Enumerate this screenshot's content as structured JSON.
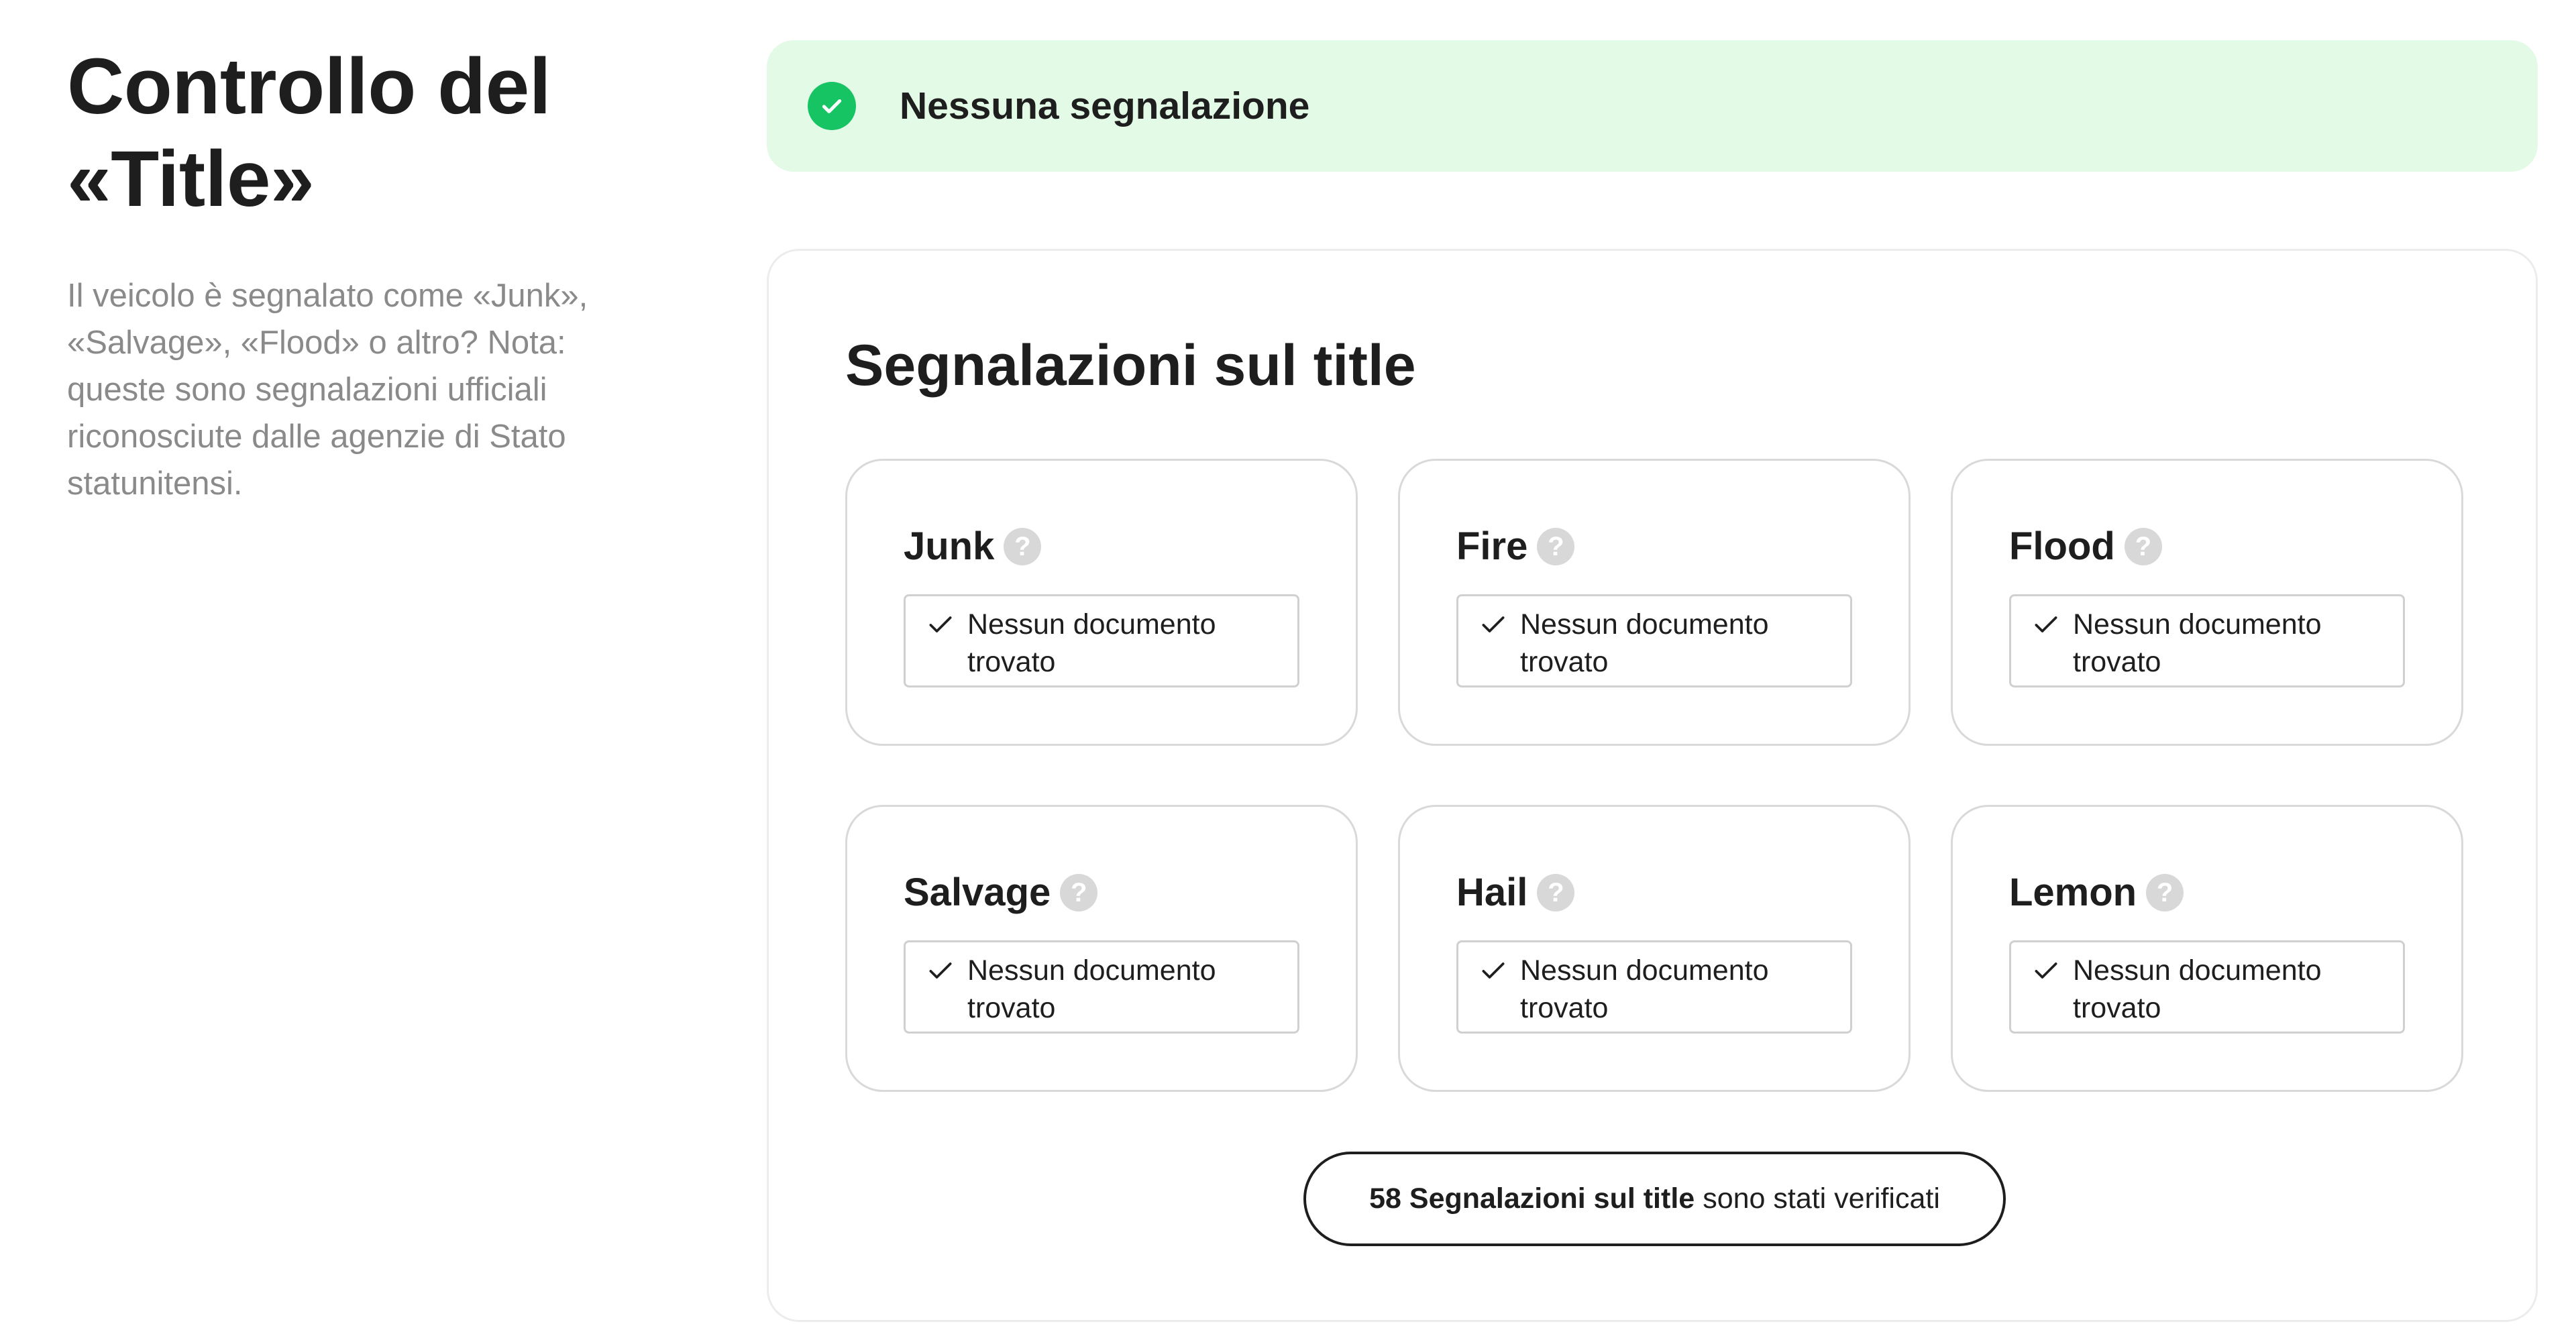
{
  "header": {
    "title": "Controllo del «Title»",
    "description": "Il veicolo è segnalato come «Junk», «Salvage», «Flood» o altro? Nota: queste sono segnalazioni ufficiali riconosciute dalle agenzie di Stato statunitensi."
  },
  "status_banner": {
    "icon": "check-circle-icon",
    "text": "Nessuna segnalazione",
    "background_color": "#e2fae6",
    "icon_color": "#16c463"
  },
  "panel": {
    "title": "Segnalazioni sul title",
    "cards": [
      {
        "label": "Junk",
        "help_icon": "?",
        "status_icon": "check-icon",
        "status": "Nessun documento trovato"
      },
      {
        "label": "Fire",
        "help_icon": "?",
        "status_icon": "check-icon",
        "status": "Nessun documento trovato"
      },
      {
        "label": "Flood",
        "help_icon": "?",
        "status_icon": "check-icon",
        "status": "Nessun documento trovato"
      },
      {
        "label": "Salvage",
        "help_icon": "?",
        "status_icon": "check-icon",
        "status": "Nessun documento trovato"
      },
      {
        "label": "Hail",
        "help_icon": "?",
        "status_icon": "check-icon",
        "status": "Nessun documento trovato"
      },
      {
        "label": "Lemon",
        "help_icon": "?",
        "status_icon": "check-icon",
        "status": "Nessun documento trovato"
      }
    ],
    "summary": {
      "bold_text": "58 Segnalazioni sul title",
      "rest_text": "sono stati verificati"
    }
  }
}
